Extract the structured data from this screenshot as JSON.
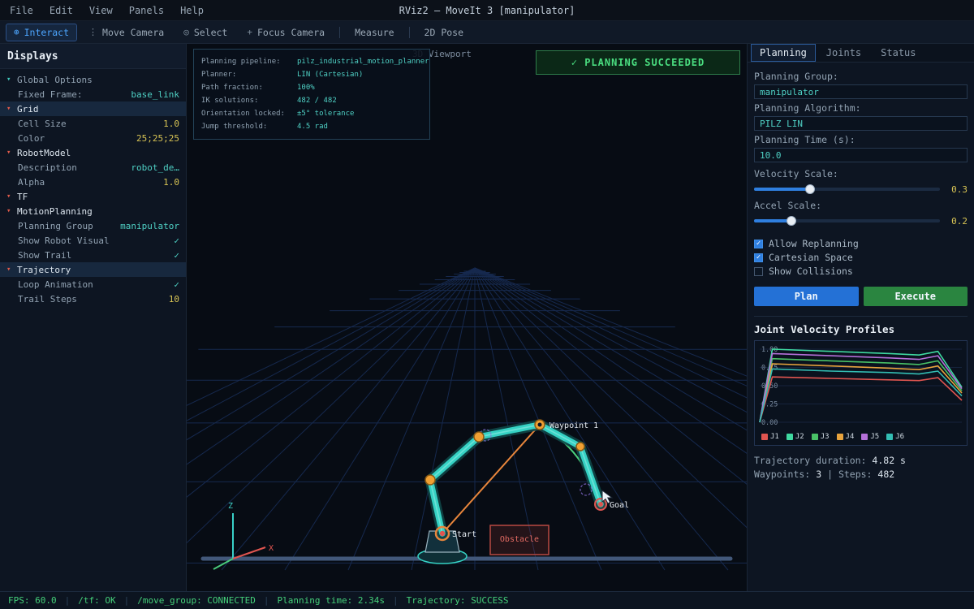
{
  "window": {
    "title": "RViz2  —  MoveIt 3  [manipulator]"
  },
  "menu": {
    "items": [
      "File",
      "Edit",
      "View",
      "Panels",
      "Help"
    ]
  },
  "toolbar": {
    "tools": [
      {
        "icon": "⊕",
        "label": "Interact",
        "active": true
      },
      {
        "icon": "⋮",
        "label": "Move Camera",
        "active": false
      },
      {
        "icon": "◎",
        "label": "Select",
        "active": false
      },
      {
        "icon": "+",
        "label": "Focus Camera",
        "active": false
      },
      {
        "icon": "",
        "label": "Measure",
        "active": false,
        "sep": true
      },
      {
        "icon": "",
        "label": "2D Pose",
        "active": false,
        "sep": true
      }
    ]
  },
  "displays": {
    "title": "Displays",
    "rows": [
      {
        "arrow": "▾",
        "arrowColor": "teal",
        "label": "Global Options",
        "indent": 0
      },
      {
        "label": "Fixed Frame:",
        "value": "base_link",
        "valueColor": "teal",
        "indent": 1
      },
      {
        "arrow": "▾",
        "arrowColor": "red",
        "label": "Grid",
        "labelColor": "white",
        "highlight": true,
        "indent": 0
      },
      {
        "label": "Cell Size",
        "value": "1.0",
        "valueColor": "yellow",
        "indent": 1
      },
      {
        "label": "Color",
        "value": "25;25;25",
        "valueColor": "yellow",
        "indent": 1
      },
      {
        "arrow": "▾",
        "arrowColor": "red",
        "label": "RobotModel",
        "labelColor": "white",
        "indent": 0
      },
      {
        "label": "Description",
        "value": "robot_de…",
        "valueColor": "teal",
        "indent": 1
      },
      {
        "label": "Alpha",
        "value": "1.0",
        "valueColor": "yellow",
        "indent": 1
      },
      {
        "arrow": "▾",
        "arrowColor": "red",
        "label": "TF",
        "labelColor": "white",
        "indent": 0
      },
      {
        "arrow": "▾",
        "arrowColor": "red",
        "label": "MotionPlanning",
        "labelColor": "white",
        "indent": 0
      },
      {
        "label": "Planning Group",
        "value": "manipulator",
        "valueColor": "teal",
        "indent": 1
      },
      {
        "label": "Show Robot Visual",
        "value": "✓",
        "valueColor": "teal",
        "indent": 1
      },
      {
        "label": "Show Trail",
        "value": "✓",
        "valueColor": "teal",
        "indent": 1
      },
      {
        "arrow": "▾",
        "arrowColor": "red",
        "label": "Trajectory",
        "labelColor": "white",
        "highlight": true,
        "indent": 0
      },
      {
        "label": "Loop Animation",
        "value": "✓",
        "valueColor": "teal",
        "indent": 1
      },
      {
        "label": "Trail Steps",
        "value": "10",
        "valueColor": "yellow",
        "indent": 1
      }
    ]
  },
  "viewport": {
    "title": "3D Viewport",
    "banner": "✓ PLANNING SUCCEEDED",
    "info": {
      "rows": [
        {
          "label": "Planning pipeline:",
          "value": "pilz_industrial_motion_planner"
        },
        {
          "label": "Planner:",
          "value": "LIN (Cartesian)"
        },
        {
          "label": "Path fraction:",
          "value": "100%"
        },
        {
          "label": "IK solutions:",
          "value": "482 / 482"
        },
        {
          "label": "Orientation locked:",
          "value": "±5° tolerance"
        },
        {
          "label": "Jump threshold:",
          "value": "4.5 rad"
        }
      ]
    },
    "markers": {
      "start": "Start",
      "waypoint": "Waypoint 1",
      "goal": "Goal",
      "obstacle": "Obstacle"
    },
    "axes": {
      "x": "X",
      "z": "Z"
    }
  },
  "panel": {
    "tabs": [
      {
        "label": "Planning",
        "active": true
      },
      {
        "label": "Joints",
        "active": false
      },
      {
        "label": "Status",
        "active": false
      }
    ],
    "fields": [
      {
        "label": "Planning Group:",
        "value": "manipulator"
      },
      {
        "label": "Planning Algorithm:",
        "value": "PILZ LIN"
      },
      {
        "label": "Planning Time (s):",
        "value": "10.0"
      }
    ],
    "sliders": [
      {
        "label": "Velocity Scale:",
        "value": "0.3"
      },
      {
        "label": "Accel Scale:",
        "value": "0.2"
      }
    ],
    "checkboxes": [
      {
        "label": "Allow Replanning",
        "checked": true
      },
      {
        "label": "Cartesian Space",
        "checked": true
      },
      {
        "label": "Show Collisions",
        "checked": false
      }
    ],
    "buttons": {
      "plan": "Plan",
      "execute": "Execute"
    },
    "chart_title": "Joint Velocity Profiles",
    "footer": [
      {
        "segments": [
          {
            "text": "Trajectory duration:",
            "muted": true
          },
          {
            "text": "4.82 s",
            "muted": false
          }
        ]
      },
      {
        "segments": [
          {
            "text": "Waypoints:",
            "muted": true
          },
          {
            "text": "3",
            "muted": false
          },
          {
            "text": "|",
            "muted": true
          },
          {
            "text": "Steps:",
            "muted": true
          },
          {
            "text": "482",
            "muted": false
          }
        ]
      }
    ]
  },
  "status": {
    "items": [
      "FPS: 60.0",
      "/tf: OK",
      "/move_group: CONNECTED",
      "Planning time: 2.34s",
      "Trajectory: SUCCESS"
    ]
  },
  "chart_data": {
    "type": "line",
    "title": "Joint Velocity Profiles",
    "xlabel": "",
    "ylabel": "",
    "x": [
      0,
      0.3,
      1.7,
      3.1,
      3.8,
      4.25,
      4.82
    ],
    "ylim": [
      0,
      1.0
    ],
    "yticks": [
      "1.00",
      "0.75",
      "0.50",
      "0.25",
      "0.00"
    ],
    "legend_position": "bottom",
    "series": [
      {
        "name": "J1",
        "color": "#e05550",
        "values": [
          0,
          0.62,
          0.6,
          0.58,
          0.57,
          0.61,
          0.3
        ]
      },
      {
        "name": "J2",
        "color": "#3fd9a0",
        "values": [
          0,
          1.0,
          0.97,
          0.94,
          0.92,
          0.97,
          0.48
        ]
      },
      {
        "name": "J3",
        "color": "#49c267",
        "values": [
          0,
          0.87,
          0.84,
          0.81,
          0.79,
          0.84,
          0.43
        ]
      },
      {
        "name": "J4",
        "color": "#e8a33d",
        "values": [
          0,
          0.8,
          0.77,
          0.74,
          0.72,
          0.77,
          0.4
        ]
      },
      {
        "name": "J5",
        "color": "#b470d8",
        "values": [
          0,
          0.94,
          0.91,
          0.88,
          0.86,
          0.91,
          0.46
        ]
      },
      {
        "name": "J6",
        "color": "#33bdb3",
        "values": [
          0,
          0.73,
          0.7,
          0.68,
          0.66,
          0.7,
          0.36
        ]
      }
    ]
  }
}
